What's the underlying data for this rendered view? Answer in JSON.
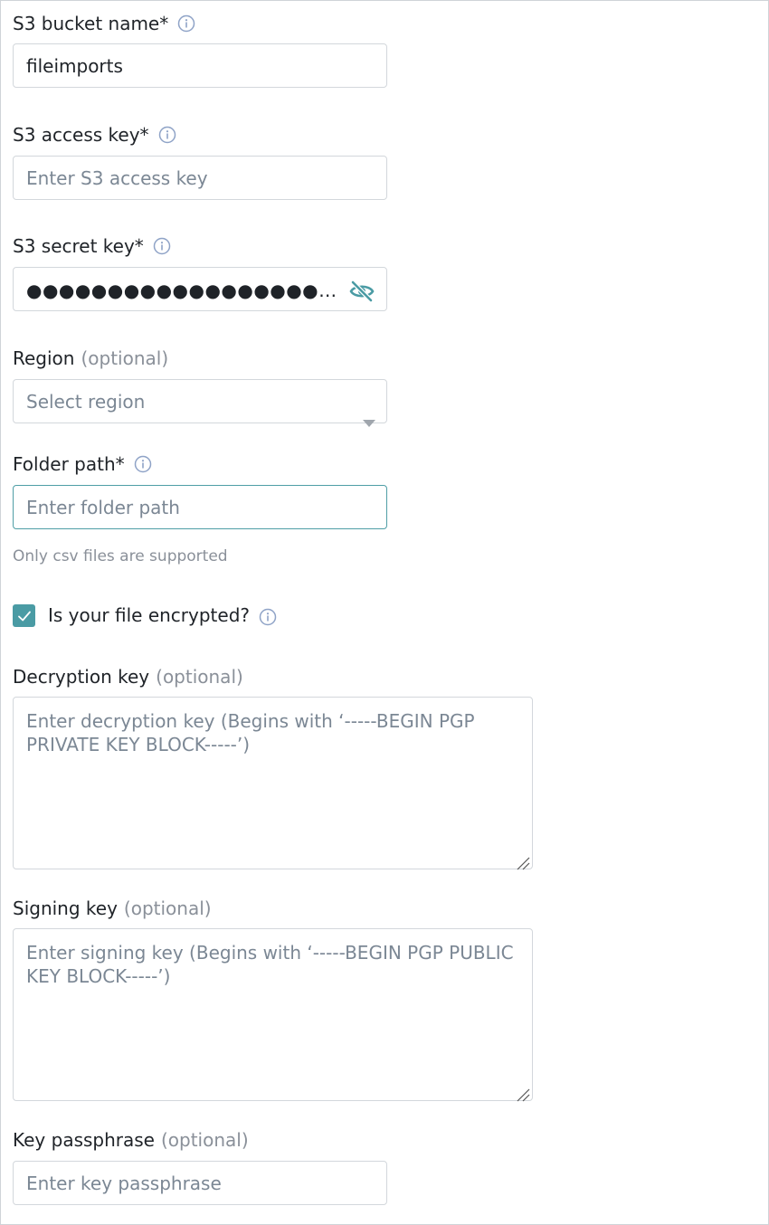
{
  "fields": {
    "bucket": {
      "label": "S3 bucket name*",
      "value": "fileimports"
    },
    "access_key": {
      "label": "S3 access key*",
      "placeholder": "Enter S3 access key"
    },
    "secret_key": {
      "label": "S3 secret key*",
      "masked_value": "●●●●●●●●●●●●●●●●●●●●●●●●●●●●●●●●●●",
      "toggle_icon": "eye-slash-icon"
    },
    "region": {
      "label": "Region",
      "optional": "(optional)",
      "placeholder": "Select region"
    },
    "folder_path": {
      "label": "Folder path*",
      "placeholder": "Enter folder path",
      "helper": "Only csv files are supported"
    },
    "encrypted": {
      "label": "Is your file encrypted?",
      "checked": true
    },
    "decryption_key": {
      "label": "Decryption key",
      "optional": "(optional)",
      "placeholder": "Enter decryption key (Begins with ‘-----BEGIN PGP PRIVATE KEY BLOCK-----’)"
    },
    "signing_key": {
      "label": "Signing key",
      "optional": "(optional)",
      "placeholder": "Enter signing key (Begins with ‘-----BEGIN PGP PUBLIC KEY BLOCK-----’)"
    },
    "passphrase": {
      "label": "Key passphrase",
      "optional": "(optional)",
      "placeholder": "Enter key passphrase"
    }
  },
  "colors": {
    "accent": "#4a9ba4",
    "placeholder": "#7b8794",
    "border": "#d3d7dc",
    "info_icon": "#8fa3c7"
  }
}
